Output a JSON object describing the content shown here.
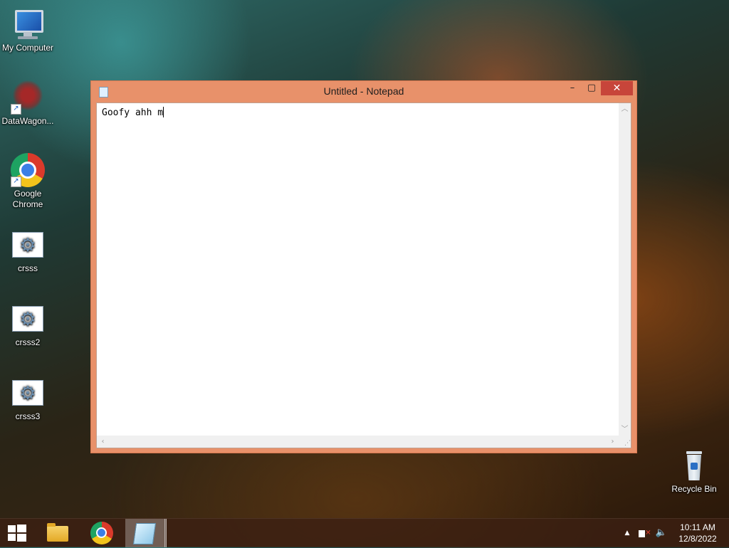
{
  "desktop": {
    "icons": [
      {
        "label": "My Computer"
      },
      {
        "label": "DataWagon..."
      },
      {
        "label": "Google Chrome"
      },
      {
        "label": "crsss"
      },
      {
        "label": "crsss2"
      },
      {
        "label": "crsss3"
      },
      {
        "label": "Recycle Bin"
      }
    ]
  },
  "notepad": {
    "title": "Untitled - Notepad",
    "content": "Goofy ahh m",
    "buttons": {
      "minimize": "–",
      "maximize": "▢",
      "close": "✕"
    }
  },
  "taskbar": {
    "apps": [
      "start-button",
      "file-explorer-icon",
      "chrome-icon",
      "notepad-icon"
    ],
    "tray_chevron": "▲",
    "clock_time": "10:11 AM",
    "clock_date": "12/8/2022"
  },
  "colors": {
    "window_frame": "#e8916a",
    "close_button": "#c7453a",
    "taskbar": "#3c2012"
  }
}
